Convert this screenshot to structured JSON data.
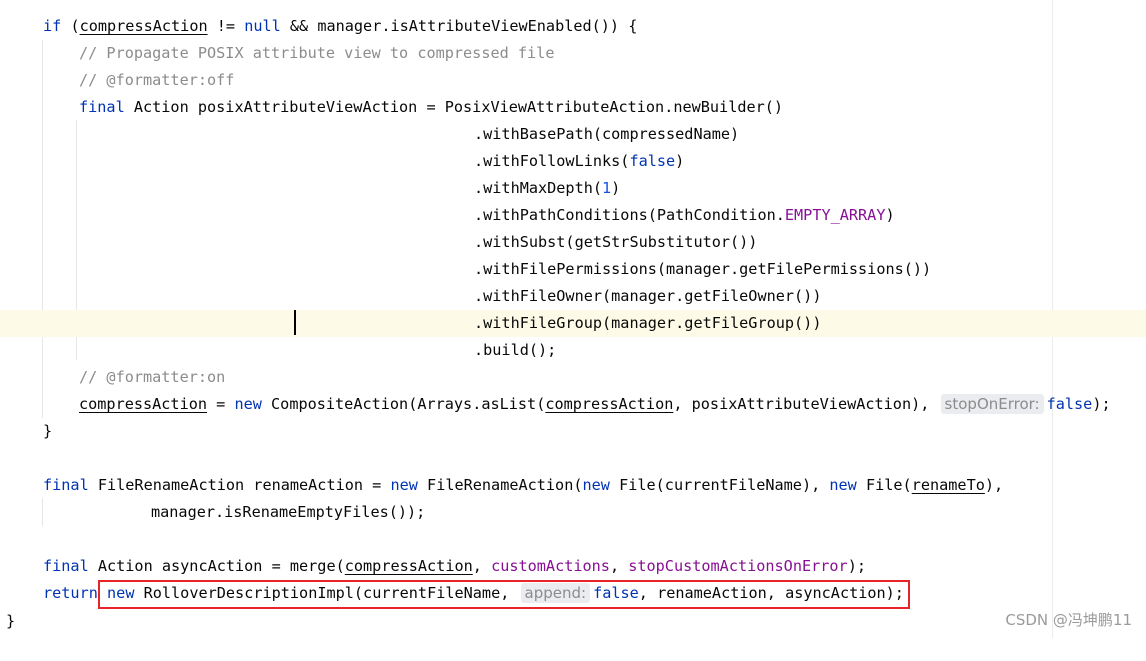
{
  "code": {
    "l1": {
      "a": "if",
      "b": " (",
      "c": "compressAction",
      "d": " != ",
      "e": "null",
      "f": " && manager.isAttributeViewEnabled()) {"
    },
    "l2": {
      "a": "// Propagate POSIX attribute view to compressed file"
    },
    "l3": {
      "a": "// @formatter:off"
    },
    "l4": {
      "a": "final",
      "b": " Action posixAttributeViewAction = PosixViewAttributeAction.newBuilder()"
    },
    "l5": {
      "a": ".withBasePath(compressedName)"
    },
    "l6": {
      "a": ".withFollowLinks(",
      "b": "false",
      "c": ")"
    },
    "l7": {
      "a": ".withMaxDepth(",
      "b": "1",
      "c": ")"
    },
    "l8": {
      "a": ".withPathConditions(PathCondition.",
      "b": "EMPTY_ARRAY",
      "c": ")"
    },
    "l9": {
      "a": ".withSubst(getStrSubstitutor())"
    },
    "l10": {
      "a": ".withFilePermissions(manager.getFilePermissions())"
    },
    "l11": {
      "a": ".withFileOwner(manager.getFileOwner())"
    },
    "l12": {
      "a": ".withFileGroup(manager.getFileGroup())"
    },
    "l13": {
      "a": ".build();"
    },
    "l14": {
      "a": "// @formatter:on"
    },
    "l15": {
      "a": "compressAction",
      "b": " = ",
      "c": "new",
      "d": " CompositeAction(Arrays.asList(",
      "e": "compressAction",
      "f": ", posixAttributeViewAction),",
      "hint": "stopOnError:",
      "g": "false",
      "h": ");"
    },
    "l16": {
      "a": "}"
    },
    "l17": {
      "a": "final",
      "b": " FileRenameAction renameAction = ",
      "c": "new",
      "d": " FileRenameAction(",
      "e": "new",
      "f": " File(currentFileName), ",
      "g": "new",
      "h": " File(",
      "i": "renameTo",
      "j": "),"
    },
    "l18": {
      "a": "manager.isRenameEmptyFiles());"
    },
    "l19": {
      "a": "final",
      "b": " Action asyncAction = merge(",
      "c": "compressAction",
      "d": ", ",
      "e": "customActions",
      "f": ", ",
      "g": "stopCustomActionsOnError",
      "h": ");"
    },
    "l20": {
      "a": "return",
      "b": " ",
      "c": "new",
      "d": " RolloverDescriptionImpl(currentFileName,",
      "hint": "append:",
      "e": "false",
      "f": ", renameAction, asyncAction);"
    },
    "l21": {
      "a": "}"
    }
  },
  "watermark": "CSDN @冯坤鹏11",
  "colors": {
    "keyword": "#0033b3",
    "comment": "#8c8c8c",
    "number": "#1750eb",
    "constant": "#871094",
    "highlight_box": "#e8242b",
    "current_line": "#fdfbe8"
  }
}
